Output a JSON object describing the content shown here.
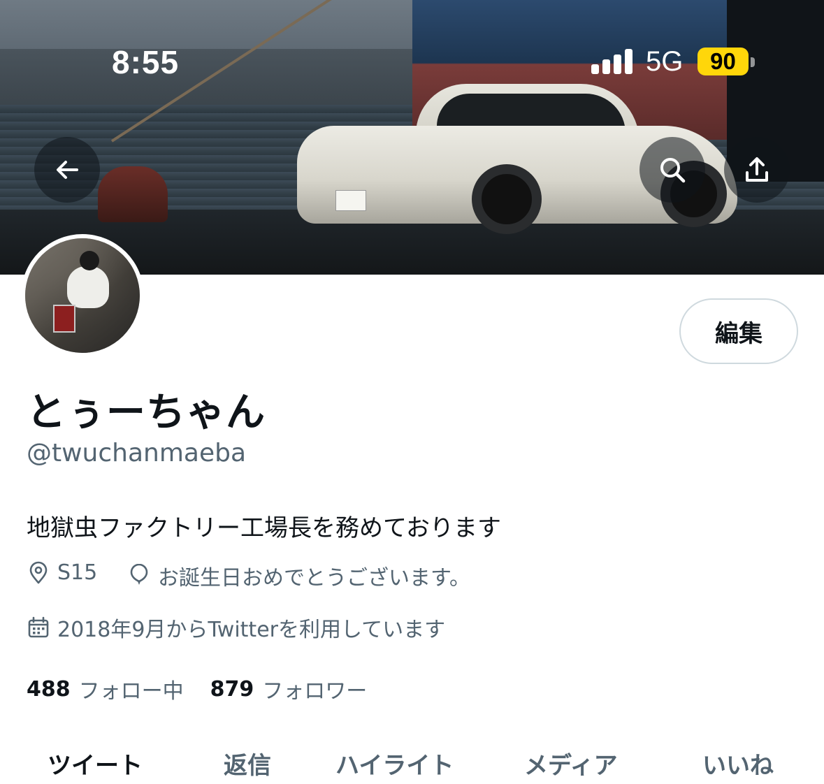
{
  "status_bar": {
    "time": "8:55",
    "network": "5G",
    "battery": "90",
    "battery_color": "#ffd60a"
  },
  "header": {
    "back_icon": "arrow-left-icon",
    "search_icon": "search-icon",
    "share_icon": "share-upload-icon"
  },
  "profile": {
    "edit_label": "編集",
    "display_name": "とぅーちゃん",
    "handle": "@twuchanmaeba",
    "bio": "地獄虫ファクトリー工場長を務めております",
    "location": "S15",
    "birthday": "お誕生日おめでとうございます。",
    "joined": "2018年9月からTwitterを利用しています",
    "following_count": "488",
    "following_label": "フォロー中",
    "followers_count": "879",
    "followers_label": "フォロワー"
  },
  "tabs": [
    {
      "label": "ツイート",
      "active": true
    },
    {
      "label": "返信",
      "active": false
    },
    {
      "label": "ハイライト",
      "active": false
    },
    {
      "label": "メディア",
      "active": false
    },
    {
      "label": "いいね",
      "active": false
    }
  ],
  "colors": {
    "text_primary": "#0f1419",
    "text_secondary": "#536471",
    "border": "#cfd9de"
  }
}
